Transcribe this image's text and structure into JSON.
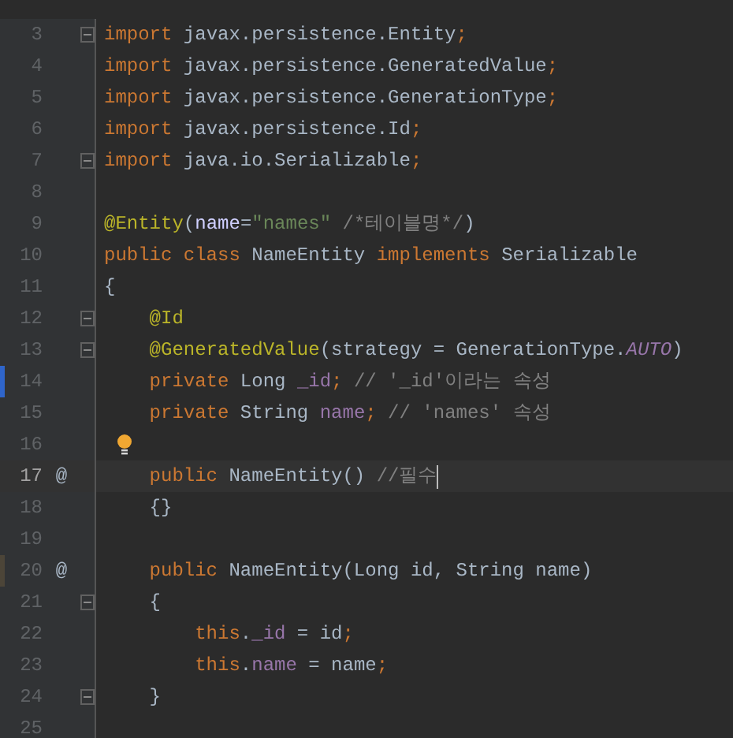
{
  "lines": [
    {
      "number": "3",
      "fold": true,
      "tokens": [
        {
          "kind": "keyword",
          "text": "import "
        },
        {
          "kind": "plain",
          "text": "javax.persistence.Entity"
        },
        {
          "kind": "keyword",
          "text": ";"
        }
      ]
    },
    {
      "number": "4",
      "tokens": [
        {
          "kind": "keyword",
          "text": "import "
        },
        {
          "kind": "plain",
          "text": "javax.persistence.GeneratedValue"
        },
        {
          "kind": "keyword",
          "text": ";"
        }
      ]
    },
    {
      "number": "5",
      "tokens": [
        {
          "kind": "keyword",
          "text": "import "
        },
        {
          "kind": "plain",
          "text": "javax.persistence.GenerationType"
        },
        {
          "kind": "keyword",
          "text": ";"
        }
      ]
    },
    {
      "number": "6",
      "tokens": [
        {
          "kind": "keyword",
          "text": "import "
        },
        {
          "kind": "plain",
          "text": "javax.persistence.Id"
        },
        {
          "kind": "keyword",
          "text": ";"
        }
      ]
    },
    {
      "number": "7",
      "fold": true,
      "tokens": [
        {
          "kind": "keyword",
          "text": "import "
        },
        {
          "kind": "plain",
          "text": "java.io.Serializable"
        },
        {
          "kind": "keyword",
          "text": ";"
        }
      ]
    },
    {
      "number": "8"
    },
    {
      "number": "9",
      "tokens": [
        {
          "kind": "annotation",
          "text": "@Entity"
        },
        {
          "kind": "plain",
          "text": "("
        },
        {
          "kind": "param",
          "text": "name"
        },
        {
          "kind": "plain",
          "text": "="
        },
        {
          "kind": "string",
          "text": "\"names\""
        },
        {
          "kind": "comment",
          "text": " /*테이블명*/"
        },
        {
          "kind": "plain",
          "text": ")"
        }
      ]
    },
    {
      "number": "10",
      "tokens": [
        {
          "kind": "keyword",
          "text": "public class "
        },
        {
          "kind": "plain",
          "text": "NameEntity "
        },
        {
          "kind": "keyword",
          "text": "implements "
        },
        {
          "kind": "plain",
          "text": "Serializable"
        }
      ]
    },
    {
      "number": "11",
      "tokens": [
        {
          "kind": "plain",
          "text": "{"
        }
      ]
    },
    {
      "number": "12",
      "fold": true,
      "tokens": [
        {
          "kind": "annotation",
          "text": "    @Id"
        }
      ]
    },
    {
      "number": "13",
      "fold": true,
      "tokens": [
        {
          "kind": "annotation",
          "text": "    @GeneratedValue"
        },
        {
          "kind": "plain",
          "text": "(strategy = GenerationType."
        },
        {
          "kind": "constant",
          "text": "AUTO"
        },
        {
          "kind": "plain",
          "text": ")"
        }
      ]
    },
    {
      "number": "14",
      "color": "#2f65ca",
      "tokens": [
        {
          "kind": "keyword",
          "text": "    private "
        },
        {
          "kind": "plain",
          "text": "Long "
        },
        {
          "kind": "field",
          "text": "_id"
        },
        {
          "kind": "keyword",
          "text": ";"
        },
        {
          "kind": "comment",
          "text": " // '_id'이라는 속성"
        }
      ]
    },
    {
      "number": "15",
      "tokens": [
        {
          "kind": "keyword",
          "text": "    private "
        },
        {
          "kind": "plain",
          "text": "String "
        },
        {
          "kind": "field",
          "text": "name"
        },
        {
          "kind": "keyword",
          "text": ";"
        },
        {
          "kind": "comment",
          "text": " // 'names' 속성"
        }
      ]
    },
    {
      "number": "16",
      "bulb": true
    },
    {
      "number": "17",
      "marker": "@",
      "current": true,
      "caret": true,
      "tokens": [
        {
          "kind": "keyword",
          "text": "    public "
        },
        {
          "kind": "plain",
          "text": "NameEntity() "
        },
        {
          "kind": "comment",
          "text": "//필수"
        }
      ]
    },
    {
      "number": "18",
      "tokens": [
        {
          "kind": "plain",
          "text": "    {}"
        }
      ]
    },
    {
      "number": "19"
    },
    {
      "number": "20",
      "marker": "@",
      "color": "#4c4538",
      "tokens": [
        {
          "kind": "keyword",
          "text": "    public "
        },
        {
          "kind": "plain",
          "text": "NameEntity(Long id, String name)"
        }
      ]
    },
    {
      "number": "21",
      "fold": true,
      "tokens": [
        {
          "kind": "plain",
          "text": "    {"
        }
      ]
    },
    {
      "number": "22",
      "tokens": [
        {
          "kind": "keyword",
          "text": "        this"
        },
        {
          "kind": "plain",
          "text": "."
        },
        {
          "kind": "field",
          "text": "_id"
        },
        {
          "kind": "plain",
          "text": " = id"
        },
        {
          "kind": "keyword",
          "text": ";"
        }
      ]
    },
    {
      "number": "23",
      "tokens": [
        {
          "kind": "keyword",
          "text": "        this"
        },
        {
          "kind": "plain",
          "text": "."
        },
        {
          "kind": "field",
          "text": "name"
        },
        {
          "kind": "plain",
          "text": " = name"
        },
        {
          "kind": "keyword",
          "text": ";"
        }
      ]
    },
    {
      "number": "24",
      "fold": true,
      "tokens": [
        {
          "kind": "plain",
          "text": "    }"
        }
      ]
    },
    {
      "number": "25"
    }
  ]
}
